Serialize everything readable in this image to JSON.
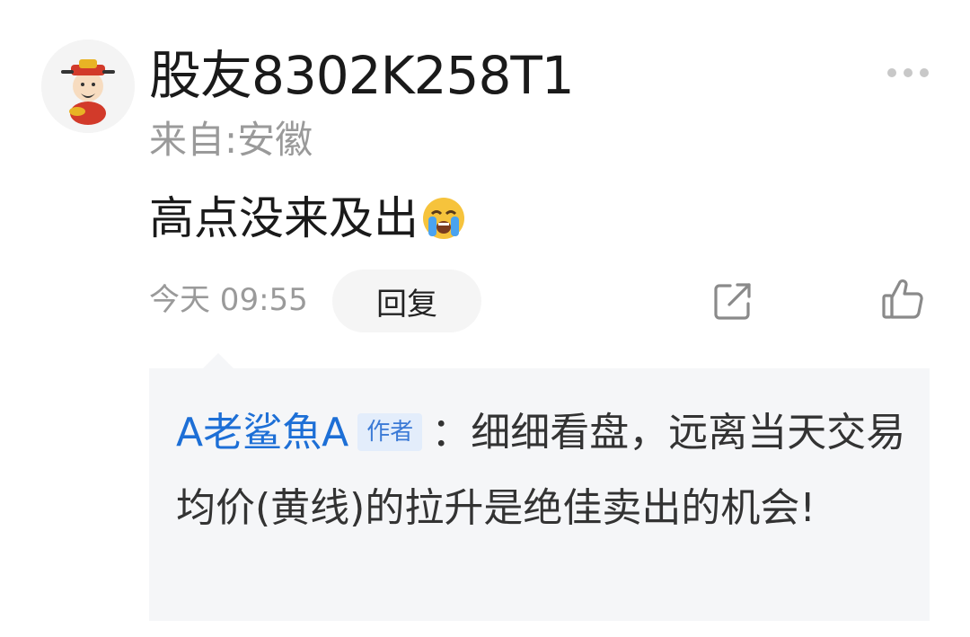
{
  "post": {
    "username": "股友8302K258T1",
    "location": "来自:安徽",
    "content": "高点没来及出",
    "emoji": "crying-face-emoji",
    "timestamp": "今天 09:55",
    "reply_label": "回复"
  },
  "reply": {
    "author": "A老鲨魚A",
    "author_tag": "作者",
    "separator": "：",
    "text": "细细看盘，远离当天交易均价(黄线)的拉升是绝佳卖出的机会!"
  },
  "icons": {
    "more": "more-icon",
    "share": "share-icon",
    "like": "thumbs-up-icon"
  },
  "colors": {
    "author_link": "#1d6fd6",
    "tag_bg": "#e3edfb",
    "muted_text": "#9a9a9a"
  }
}
